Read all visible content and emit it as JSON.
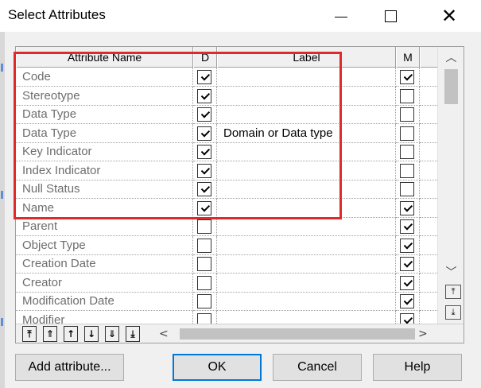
{
  "window": {
    "title": "Select Attributes",
    "controls": {
      "minimize": "—",
      "close": "✕"
    }
  },
  "grid": {
    "headers": {
      "attribute_name": "Attribute Name",
      "d": "D",
      "label": "Label",
      "m": "M"
    },
    "rows": [
      {
        "name": "Code",
        "d": true,
        "label": "",
        "m": true
      },
      {
        "name": "Stereotype",
        "d": true,
        "label": "",
        "m": false
      },
      {
        "name": "Data Type",
        "d": true,
        "label": "",
        "m": false
      },
      {
        "name": "Data Type",
        "d": true,
        "label": "Domain or Data type",
        "m": false
      },
      {
        "name": "Key Indicator",
        "d": true,
        "label": "",
        "m": false
      },
      {
        "name": "Index Indicator",
        "d": true,
        "label": "",
        "m": false
      },
      {
        "name": "Null Status",
        "d": true,
        "label": "",
        "m": false
      },
      {
        "name": "Name",
        "d": true,
        "label": "",
        "m": true
      },
      {
        "name": "Parent",
        "d": false,
        "label": "",
        "m": true
      },
      {
        "name": "Object Type",
        "d": false,
        "label": "",
        "m": true
      },
      {
        "name": "Creation Date",
        "d": false,
        "label": "",
        "m": true
      },
      {
        "name": "Creator",
        "d": false,
        "label": "",
        "m": true
      },
      {
        "name": "Modification Date",
        "d": false,
        "label": "",
        "m": true
      },
      {
        "name": "Modifier",
        "d": false,
        "label": "",
        "m": true
      }
    ],
    "nav_buttons": [
      {
        "name": "move-to-top-button",
        "glyph": "⤒"
      },
      {
        "name": "page-up-button",
        "glyph": "⇑"
      },
      {
        "name": "move-up-button",
        "glyph": "↑"
      },
      {
        "name": "move-down-button",
        "glyph": "↓"
      },
      {
        "name": "page-down-button",
        "glyph": "⇓"
      },
      {
        "name": "move-to-bottom-button",
        "glyph": "⤓"
      }
    ]
  },
  "highlight_color": "#e02a2a",
  "buttons": {
    "add_attribute": "Add attribute...",
    "ok": "OK",
    "cancel": "Cancel",
    "help": "Help"
  }
}
